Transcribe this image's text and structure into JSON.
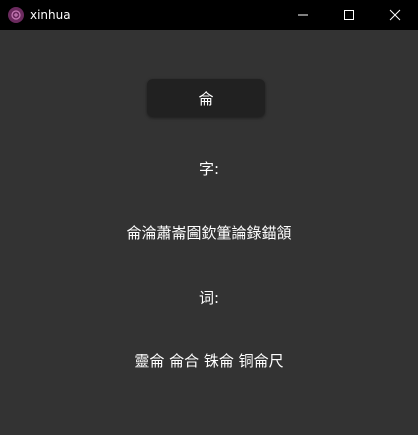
{
  "window": {
    "title": "xinhua",
    "icon": "app-logo-icon",
    "controls": {
      "minimize_icon": "minimize-icon",
      "maximize_icon": "maximize-icon",
      "close_icon": "close-icon"
    }
  },
  "main": {
    "character_button_label": "侖",
    "zi_label": "字:",
    "zi_list": "侖淪蕭崙圇欽箽論錄錨頷",
    "ci_label": "词:",
    "ci_list": "靈侖 侖合 铢侖 铜侖尺"
  },
  "colors": {
    "background": "#333333",
    "titlebar": "#000000",
    "button": "#212121",
    "text": "#ffffff",
    "icon_accent": "#6b2a5e"
  }
}
